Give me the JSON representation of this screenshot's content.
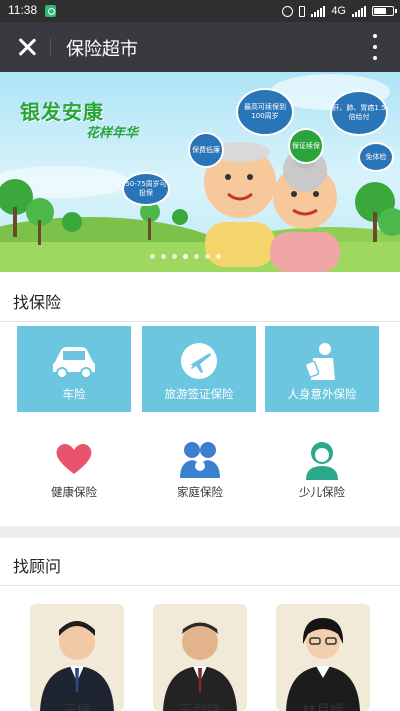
{
  "status_bar": {
    "time": "11:38",
    "network": "4G"
  },
  "title_bar": {
    "title": "保险超市"
  },
  "banner": {
    "title": "银发安康",
    "subtitle": "花样年华",
    "bubbles": [
      "最高可续保到100周岁",
      "肝、肺、胃癌1.5倍给付",
      "保费低廉",
      "保证续保",
      "免体检",
      "50-75周岁可投保"
    ],
    "slide_count": 7,
    "active_slide": 3
  },
  "find_insurance": {
    "title": "找保险",
    "tiles": [
      {
        "label": "车险",
        "icon": "car-icon"
      },
      {
        "label": "旅游签证保险",
        "icon": "airplane-icon"
      },
      {
        "label": "人身意外保险",
        "icon": "injured-person-icon"
      }
    ],
    "categories": [
      {
        "label": "健康保险",
        "icon": "heart-icon",
        "color": "#e8546b"
      },
      {
        "label": "家庭保险",
        "icon": "family-icon",
        "color": "#3a7fd0"
      },
      {
        "label": "少儿保险",
        "icon": "child-icon",
        "color": "#2aa88a"
      }
    ]
  },
  "find_advisor": {
    "title": "找顾问",
    "advisors": [
      {
        "name": "王健",
        "icon": "advisor-avatar"
      },
      {
        "name": "王剑锋",
        "icon": "advisor-avatar"
      },
      {
        "name": "林月娥",
        "icon": "advisor-avatar"
      }
    ]
  },
  "colors": {
    "tile_blue": "#6cc6e0",
    "title_bar": "#393a3f",
    "status_bar": "#2f2f2f"
  }
}
